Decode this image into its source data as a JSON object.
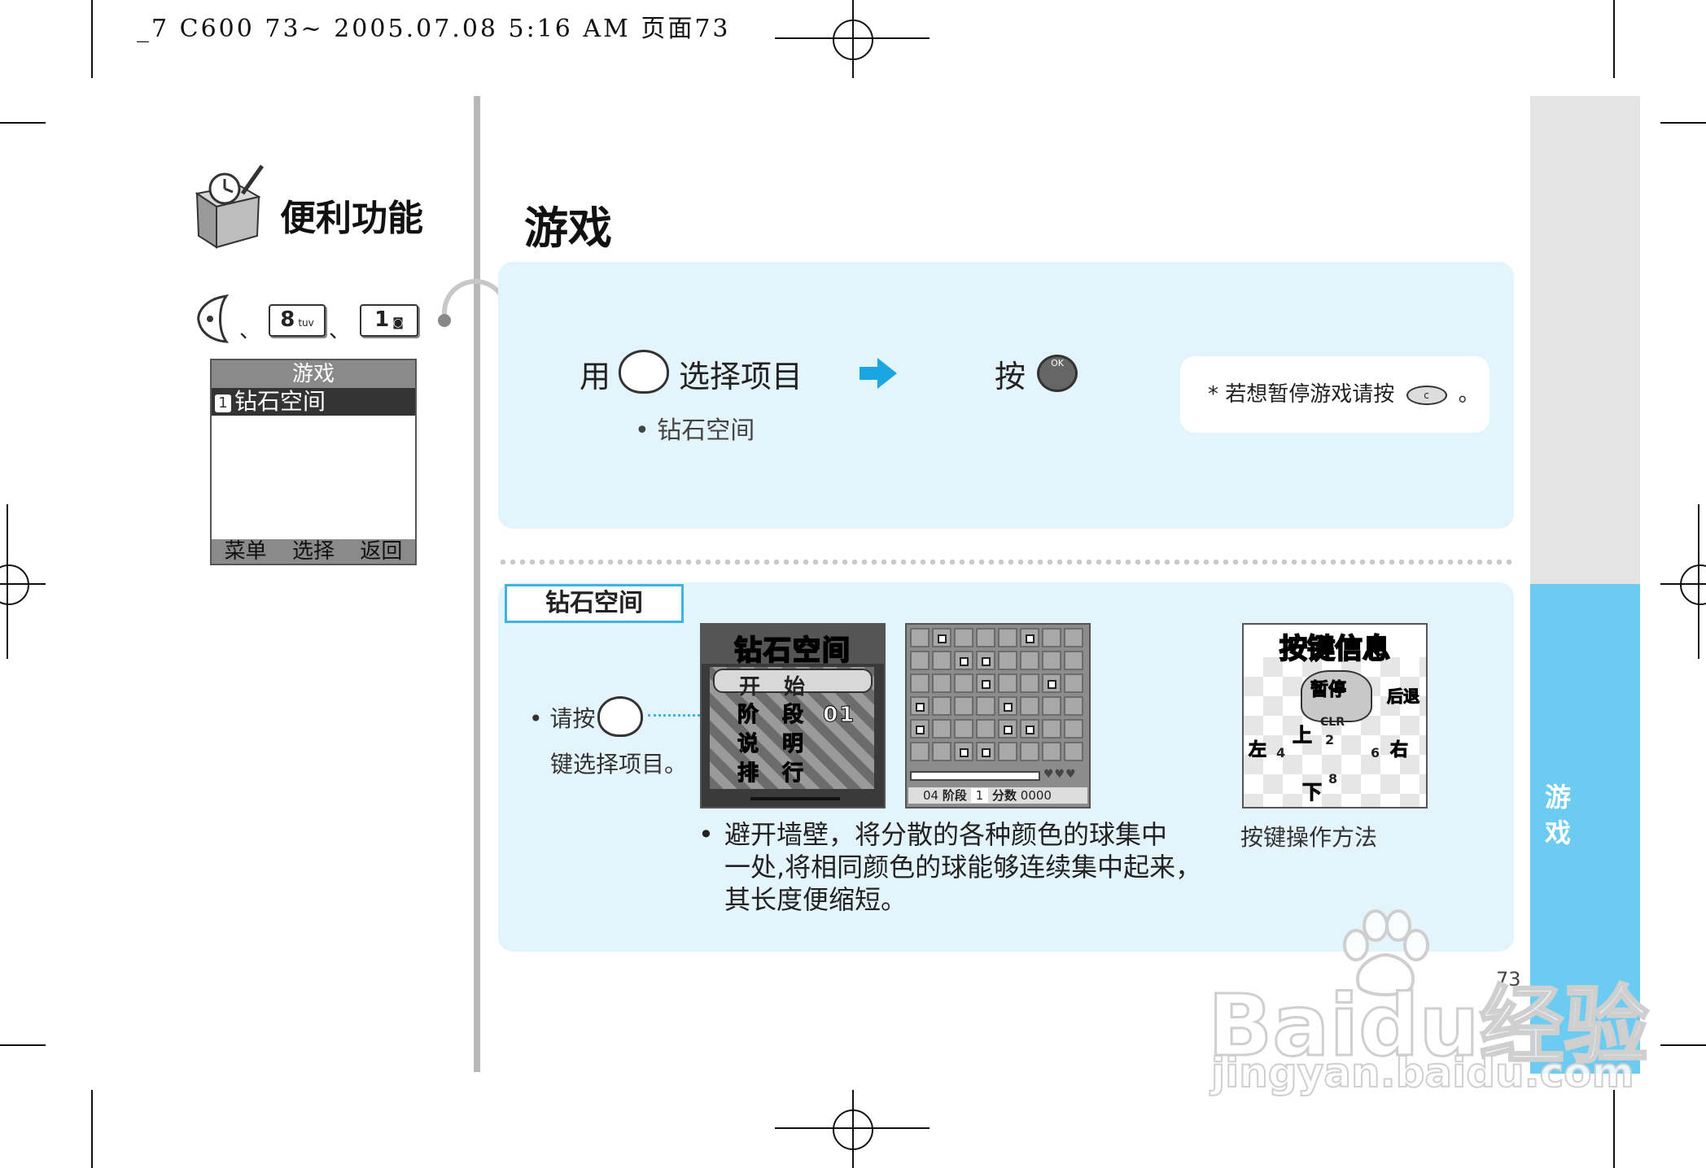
{
  "header": {
    "print_stamp": "_7 C600 73~ 2005.07.08 5:16 AM 页面73"
  },
  "left": {
    "section_title": "便利功能",
    "nav_sep": "、",
    "key_8": "8",
    "key_8_sub": "tuv",
    "key_1": "1",
    "phone": {
      "title": "游戏",
      "item_num": "1",
      "item_label": "钻石空间",
      "soft_keys": [
        "菜单",
        "选择",
        "返回"
      ]
    }
  },
  "main": {
    "page_title": "游戏",
    "step_use": "用",
    "step_select": "选择项目",
    "step_press": "按",
    "ok_label": "OK",
    "option_bullet": "钻石空间",
    "pause_note_prefix": "* 若想暂停游戏请按",
    "pause_note_suffix": "。",
    "c_key_label": "c"
  },
  "game": {
    "tag": "钻石空间",
    "press_prefix": "请按",
    "press_suffix": "键选择项目。",
    "title_screen": {
      "title": "钻石空间",
      "menu": [
        "开 始",
        "阶 段",
        "说 明",
        "排 行"
      ],
      "stage_value": "01"
    },
    "play_screen": {
      "hud": [
        "04",
        "阶段",
        "1",
        "分数",
        "0000"
      ]
    },
    "key_screen": {
      "title": "按键信息",
      "labels": [
        "暂停",
        "后退",
        "CLR",
        "上",
        "2",
        "左",
        "4",
        "6",
        "右",
        "下",
        "8"
      ]
    },
    "description": "避开墙壁，将分散的各种颜色的球集中一处,将相同颜色的球能够连续集中起来，其长度便缩短。",
    "description_lines": [
      "避开墙壁，将分散的各种颜色的球集中",
      "一处,将相同颜色的球能够连续集中起来，",
      "其长度便缩短。"
    ],
    "key_caption": "按键操作方法"
  },
  "side_tab": {
    "label": "游戏"
  },
  "page_number": "73",
  "watermark": {
    "brand": "Baidu经验",
    "url": "jingyan.baidu.com"
  },
  "colors": {
    "panel_bg": "#e4f4fb",
    "accent_blue": "#3fb4e4",
    "side_blue": "#6ccbf0",
    "arrow": "#1aa6e0"
  }
}
